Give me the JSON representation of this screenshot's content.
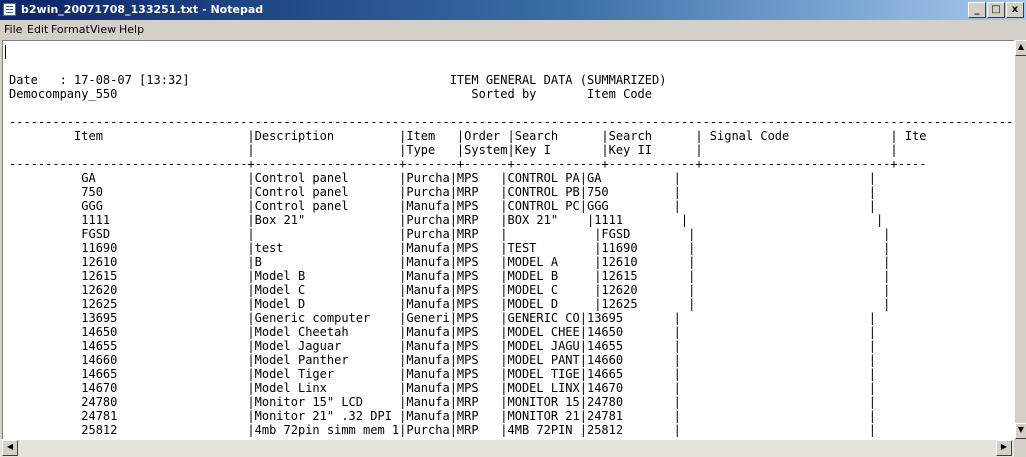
{
  "window": {
    "title": "b2win_20071708_133251.txt - Notepad",
    "minimize_glyph": "_",
    "maximize_glyph": "□",
    "close_glyph": "x"
  },
  "menu": [
    "File",
    "Edit",
    "Format",
    "View",
    "Help"
  ],
  "document": {
    "lines": [
      "",
      "",
      "Date   : 17-08-07 [13:32]                                    ITEM GENERAL DATA (SUMMARIZED)",
      "Democompany_550                                                 Sorted by       Item Code",
      "",
      "--------------------------------------------------------------------------------------------------------------------------------------------------",
      "         Item                    |Description         |Item   |Order |Search      |Search      | Signal Code              | Ite",
      "                                 |                    |Type   |System|Key I       |Key II      |                          |",
      "---------------------------------+--------------------+-------+------+------------+------------+--------------------------+----",
      "          GA                     |Control panel       |Purcha|MPS   |CONTROL PA|GA          |                          |",
      "          750                    |Control panel       |Purcha|MRP   |CONTROL PB|750         |                          |",
      "          GGG                    |Control panel       |Manufa|MPS   |CONTROL PC|GGG         |                          |",
      "          1111                   |Box 21\"             |Purcha|MRP   |BOX 21\"    |1111        |                          |",
      "          FGSD                   |                    |Purcha|MRP   |            |FGSD        |                          |",
      "          11690                  |test                |Manufa|MPS   |TEST        |11690       |                          |",
      "          12610                  |B                   |Manufa|MPS   |MODEL A     |12610       |                          |",
      "          12615                  |Model B             |Manufa|MPS   |MODEL B     |12615       |                          |",
      "          12620                  |Model C             |Manufa|MPS   |MODEL C     |12620       |                          |",
      "          12625                  |Model D             |Manufa|MPS   |MODEL D     |12625       |                          |",
      "          13695                  |Generic computer    |Generi|MPS   |GENERIC CO|13695       |                          |",
      "          14650                  |Model Cheetah       |Manufa|MPS   |MODEL CHEE|14650       |                          |",
      "          14655                  |Model Jaguar        |Manufa|MPS   |MODEL JAGU|14655       |                          |",
      "          14660                  |Model Panther       |Manufa|MPS   |MODEL PANT|14660       |                          |",
      "          14665                  |Model Tiger         |Manufa|MPS   |MODEL TIGE|14665       |                          |",
      "          14670                  |Model Linx          |Manufa|MPS   |MODEL LINX|14670       |                          |",
      "          24780                  |Monitor 15\" LCD     |Manufa|MRP   |MONITOR 15|24780       |                          |",
      "          24781                  |Monitor 21\" .32 DPI |Manufa|MRP   |MONITOR 21|24781       |                          |",
      "          25812                  |4mb 72pin simm mem 1|Purcha|MRP   |4MB 72PIN |25812       |                          |"
    ]
  },
  "icons": {
    "app": "notepad-icon",
    "scroll_up": "arrow-up-icon",
    "scroll_down": "arrow-down-icon",
    "scroll_left": "arrow-left-icon",
    "scroll_right": "arrow-right-icon"
  }
}
